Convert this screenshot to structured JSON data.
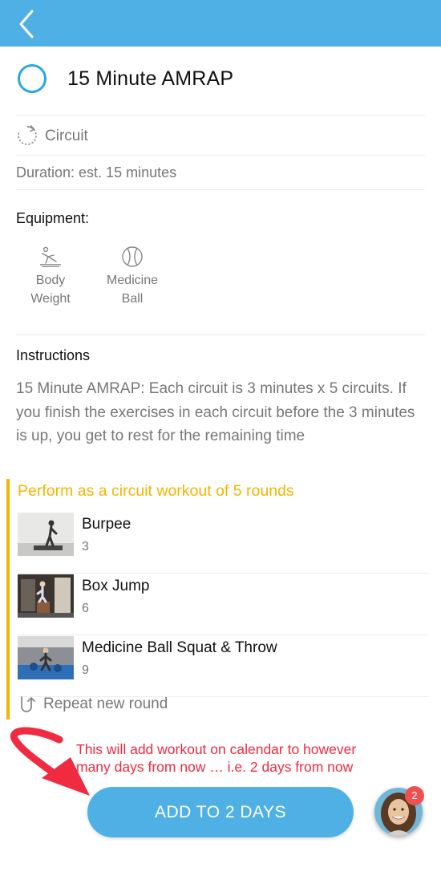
{
  "header": {
    "back_icon": "chevron-left-icon",
    "bar_color": "#4fb0e6"
  },
  "workout": {
    "title": "15 Minute AMRAP",
    "type_label": "Circuit",
    "duration": "Duration: est. 15 minutes"
  },
  "equipment": {
    "heading": "Equipment:",
    "items": [
      {
        "line1": "Body",
        "line2": "Weight",
        "icon": "bodyweight-icon"
      },
      {
        "line1": "Medicine",
        "line2": "Ball",
        "icon": "medicine-ball-icon"
      }
    ]
  },
  "instructions": {
    "heading": "Instructions",
    "text": "15 Minute AMRAP: Each circuit is 3 minutes x 5 circuits. If you finish the exercises in each circuit before the 3 minutes is up, you get to rest for the remaining time"
  },
  "circuit": {
    "heading": "Perform as a circuit workout of 5 rounds",
    "accent_color": "#f5b400",
    "exercises": [
      {
        "name": "Burpee",
        "reps": "3"
      },
      {
        "name": "Box Jump",
        "reps": "6"
      },
      {
        "name": "Medicine Ball Squat & Throw",
        "reps": "9"
      }
    ],
    "repeat_label": "Repeat new round"
  },
  "annotation": {
    "line1": "This will add workout on calendar to however",
    "line2": "many days from now … i.e. 2 days from now",
    "color": "#f02a40"
  },
  "action": {
    "add_button_label": "ADD TO 2 DAYS"
  },
  "chat": {
    "badge_count": "2"
  }
}
